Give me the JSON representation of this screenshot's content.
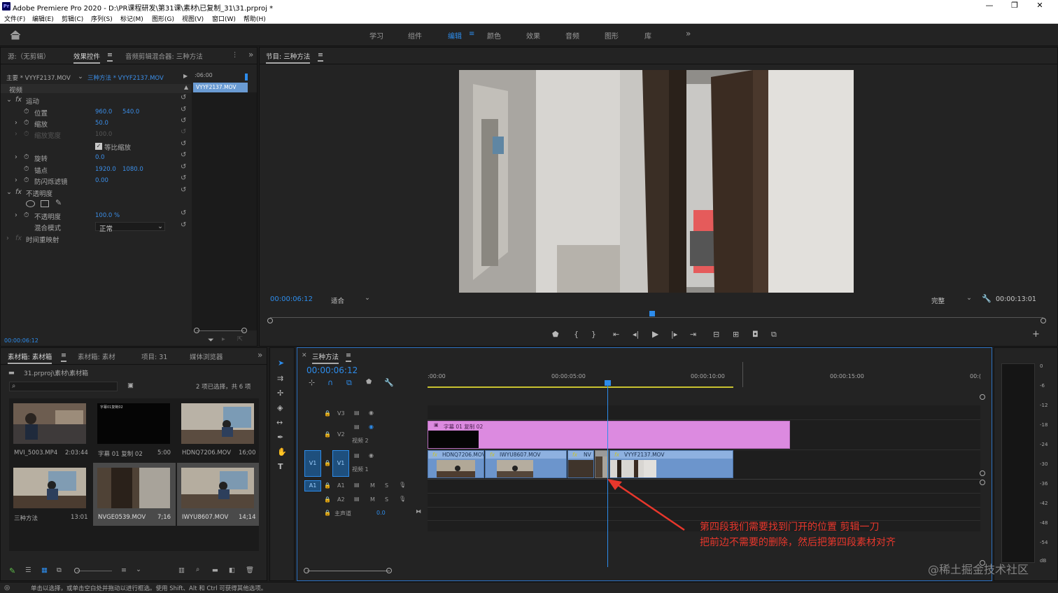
{
  "window": {
    "title": "Adobe Premiere Pro 2020 - D:\\PR课程研发\\第31课\\素材\\已复制_31\\31.prproj *",
    "logo": "Pr"
  },
  "menu": [
    "文件(F)",
    "编辑(E)",
    "剪辑(C)",
    "序列(S)",
    "标记(M)",
    "图形(G)",
    "视图(V)",
    "窗口(W)",
    "帮助(H)"
  ],
  "workspaces": [
    "学习",
    "组件",
    "编辑",
    "颜色",
    "效果",
    "音频",
    "图形",
    "库"
  ],
  "active_workspace": "编辑",
  "effect_panel": {
    "tabs": [
      "源:（无剪辑）",
      "效果控件",
      "音频剪辑混合器: 三种方法"
    ],
    "master": "主要 * VYYF2137.MOV",
    "sequence_clip": "三种方法 * VYYF2137.MOV",
    "mini_time": ":06:00",
    "mini_clip": "VYYF2137.MOV",
    "section_video": "视频",
    "motion": "运动",
    "position_label": "位置",
    "position_x": "960.0",
    "position_y": "540.0",
    "scale_label": "缩放",
    "scale_val": "50.0",
    "scale_width_label": "缩放宽度",
    "scale_width_val": "100.0",
    "uniform_label": "等比缩放",
    "rotation_label": "旋转",
    "rotation_val": "0.0",
    "anchor_label": "锚点",
    "anchor_x": "1920.0",
    "anchor_y": "1080.0",
    "flicker_label": "防闪烁滤镜",
    "flicker_val": "0.00",
    "opacity_section": "不透明度",
    "opacity_label": "不透明度",
    "opacity_val": "100.0 %",
    "blend_label": "混合模式",
    "blend_val": "正常",
    "time_remap": "时间重映射",
    "timecode": "00:00:06:12"
  },
  "program": {
    "tab": "节目: 三种方法",
    "timecode": "00:00:06:12",
    "fit": "适合",
    "quality": "完整",
    "duration": "00:00:13:01"
  },
  "project": {
    "tabs": [
      "素材箱: 素材箱",
      "素材箱: 素材",
      "项目: 31",
      "媒体浏览器"
    ],
    "path": "31.prproj\\素材\\素材箱",
    "selection": "2 项已选择，共 6 项",
    "items": [
      {
        "name": "MVI_5003.MP4",
        "dur": "2:03:44"
      },
      {
        "name": "字幕 01 复制 02",
        "dur": "5:00"
      },
      {
        "name": "HDNQ7206.MOV",
        "dur": "16;00"
      },
      {
        "name": "三种方法",
        "dur": "13:01"
      },
      {
        "name": "NVGE0539.MOV",
        "dur": "7;16"
      },
      {
        "name": "IWYU8607.MOV",
        "dur": "14;14"
      }
    ],
    "title_thumb_text": "字幕01复制02"
  },
  "timeline": {
    "tab": "三种方法",
    "timecode": "00:00:06:12",
    "ruler": [
      ":00:00",
      "00:00:05:00",
      "00:00:10:00",
      "00:00:15:00",
      "00:("
    ],
    "tracks": {
      "v3": "V3",
      "v2": "V2",
      "v2_name": "视频 2",
      "v1_src": "V1",
      "v1": "V1",
      "v1_name": "视频 1",
      "a1_src": "A1",
      "a1": "A1",
      "a2": "A2",
      "master": "主声道",
      "master_val": "0.0",
      "m": "M",
      "s": "S"
    },
    "clips": {
      "title": "字幕 01 复制 02",
      "c1": "HDNQ7206.MOV",
      "c2": "IWYU8607.MOV",
      "c3": "NV",
      "c4": "VYYF2137.MOV",
      "fx": "fx"
    }
  },
  "annotation": {
    "line1": "第四段我们需要找到门开的位置 剪辑一刀",
    "line2": "把前边不需要的删除，然后把第四段素材对齐"
  },
  "meter_scale": [
    "0",
    "-6",
    "-12",
    "-18",
    "-24",
    "-30",
    "-36",
    "-42",
    "-48",
    "-54",
    "dB"
  ],
  "status": "单击以选择，或单击空白处并拖动以进行框选。使用 Shift、Alt 和 Ctrl 可获得其他选项。",
  "watermark": "@稀土掘金技术社区",
  "colors": {
    "accent": "#2d8ceb",
    "title_clip": "#dc8ae0",
    "video_clip": "#6c95cc",
    "annotation": "#e8372c"
  }
}
